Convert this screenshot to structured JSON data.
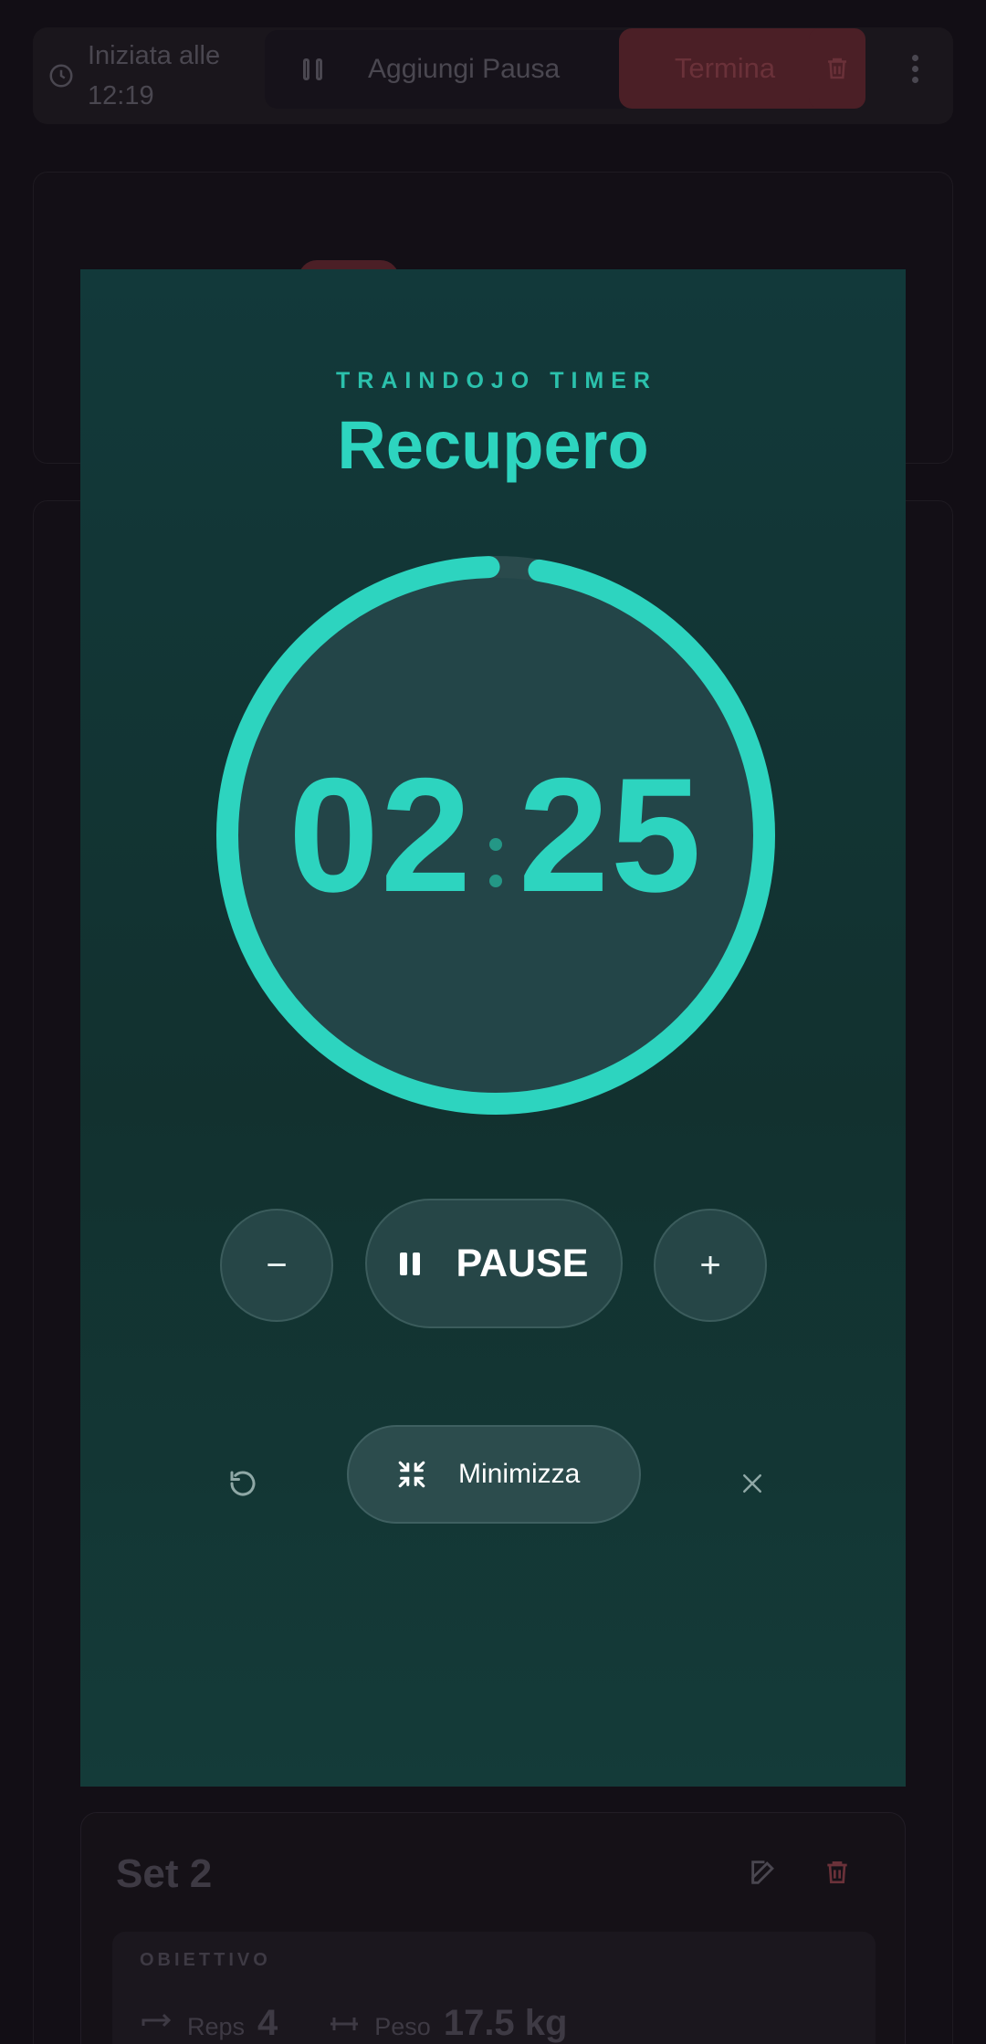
{
  "topbar": {
    "started_label": "Iniziata alle",
    "started_time": "12:19",
    "add_pause_label": "Aggiungi Pausa",
    "end_label": "Termina"
  },
  "timer": {
    "brand": "TRAINDOJO TIMER",
    "mode": "Recupero",
    "minutes": "02",
    "seconds": "25",
    "progress_fraction": 0.97,
    "decrease_label": "−",
    "pause_label": "PAUSE",
    "increase_label": "+",
    "minimize_label": "Minimizza",
    "accent_color": "#2dd4bf"
  },
  "set": {
    "title": "Set 2",
    "objective_label": "OBIETTIVO",
    "reps_label": "Reps",
    "reps_value": "4",
    "weight_label": "Peso",
    "weight_value": "17.5 kg"
  },
  "icons": {
    "clock": "clock-icon",
    "pause": "pause-icon",
    "trash": "trash-icon",
    "more": "more-vertical-icon",
    "restart": "restart-icon",
    "minimize": "minimize-icon",
    "close": "close-icon",
    "edit": "edit-icon",
    "reps": "repeat-icon",
    "weight": "weight-icon"
  }
}
